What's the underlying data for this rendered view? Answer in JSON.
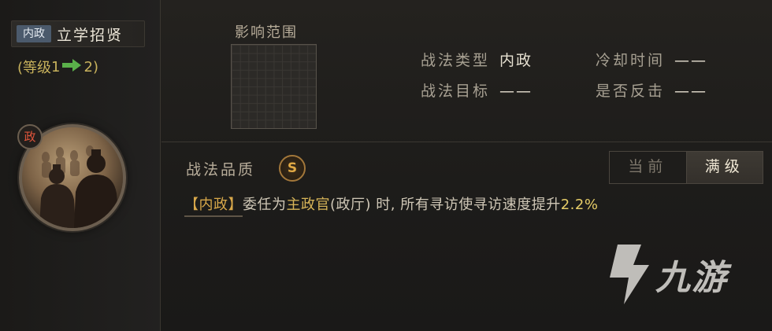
{
  "skill": {
    "category_tag": "内政",
    "name": "立学招贤",
    "level_open": "(等级",
    "level_from": "1",
    "level_to": "2",
    "level_close": ")"
  },
  "portrait": {
    "badge": "政",
    "icon": "officials-portrait"
  },
  "range": {
    "label": "影响范围"
  },
  "attributes": {
    "type_label": "战法类型",
    "type_value": "内政",
    "target_label": "战法目标",
    "target_value": "——",
    "cooldown_label": "冷却时间",
    "cooldown_value": "——",
    "counter_label": "是否反击",
    "counter_value": "——"
  },
  "quality": {
    "label": "战法品质",
    "grade": "S"
  },
  "toggle": {
    "current": "当前",
    "max": "满级",
    "selected": "max"
  },
  "description": {
    "tag": "【内政】",
    "part1": "委任为",
    "role": "主政官",
    "part2": "(政厅) 时, 所有寻访使寻访速度提升",
    "value": "2.2%"
  },
  "watermark": {
    "text": "九游"
  },
  "colors": {
    "accent_gold": "#d8a84a",
    "level_arrow": "#5ab04a",
    "badge_red": "#e0553b"
  }
}
